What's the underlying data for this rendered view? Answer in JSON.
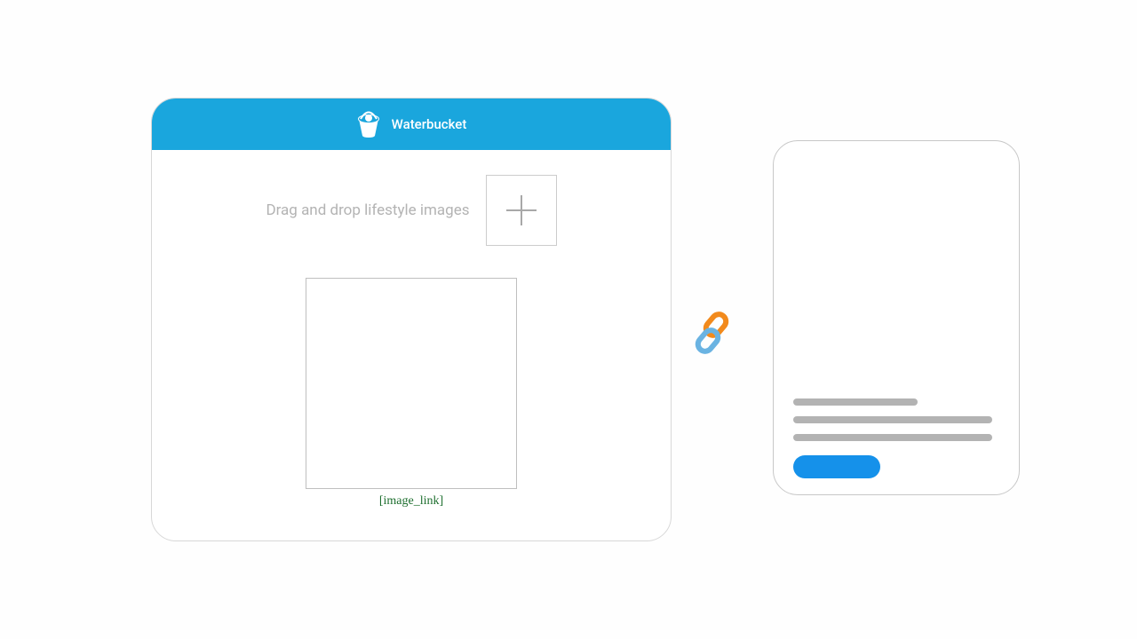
{
  "panel": {
    "title": "Waterbucket",
    "drop_text": "Drag and drop lifestyle images",
    "preview_label": "[image_link]"
  },
  "colors": {
    "header": "#1aa6dd",
    "button": "#1591ea",
    "link_orange": "#f28a1c",
    "link_blue": "#5aa9e0",
    "skeleton": "#b3b3b3"
  }
}
